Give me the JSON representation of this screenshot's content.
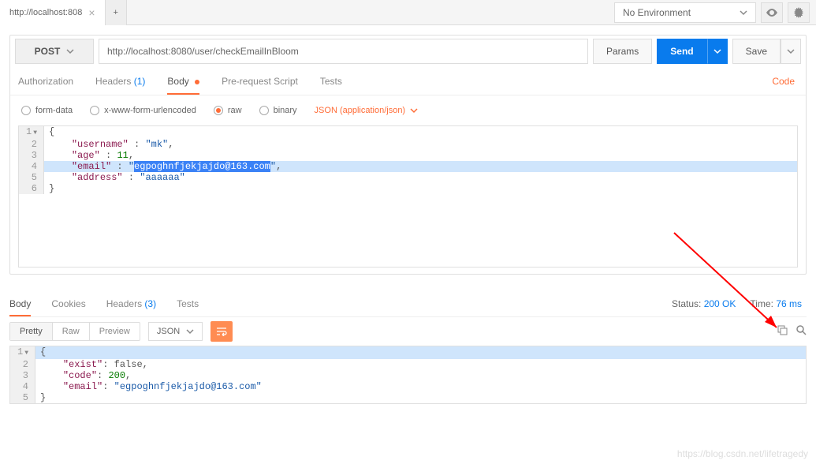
{
  "top": {
    "tab_title": "http://localhost:808",
    "environment": "No Environment"
  },
  "request": {
    "method": "POST",
    "url": "http://localhost:8080/user/checkEmailInBloom",
    "buttons": {
      "params": "Params",
      "send": "Send",
      "save": "Save"
    },
    "tabs": {
      "authorization": "Authorization",
      "headers": "Headers",
      "headers_count": "(1)",
      "body": "Body",
      "prerequest": "Pre-request Script",
      "tests": "Tests"
    },
    "code_link": "Code",
    "body_options": {
      "formdata": "form-data",
      "urlencoded": "x-www-form-urlencoded",
      "raw": "raw",
      "binary": "binary",
      "content_type": "JSON (application/json)"
    },
    "body_json": {
      "username": "mk",
      "age": 11,
      "email": "egpoghnfjekjajdo@163.com",
      "address": "aaaaaa"
    }
  },
  "response": {
    "tabs": {
      "body": "Body",
      "cookies": "Cookies",
      "headers": "Headers",
      "headers_count": "(3)",
      "tests": "Tests"
    },
    "status_label": "Status:",
    "status_value": "200 OK",
    "time_label": "Time:",
    "time_value": "76 ms",
    "views": {
      "pretty": "Pretty",
      "raw": "Raw",
      "preview": "Preview"
    },
    "format": "JSON",
    "body_json": {
      "exist": false,
      "code": 200,
      "email": "egpoghnfjekjajdo@163.com"
    }
  },
  "watermark": "https://blog.csdn.net/lifetragedy"
}
